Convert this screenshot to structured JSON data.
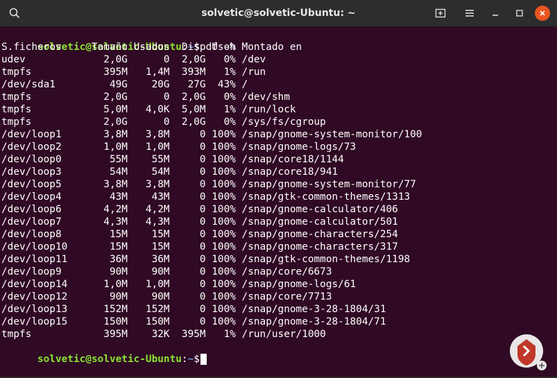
{
  "window": {
    "title": "solvetic@solvetic-Ubuntu: ~"
  },
  "icons": {
    "search": "search-icon",
    "new_tab": "new-tab-icon",
    "menu": "hamburger-menu-icon",
    "minimize": "minimize-icon",
    "maximize": "maximize-icon",
    "close": "close-icon"
  },
  "colors": {
    "background": "#300a24",
    "prompt_user": "#8ae234",
    "prompt_path": "#729fcf",
    "close_button": "#e95420",
    "text": "#ffffff"
  },
  "prompt": {
    "user_host": "solvetic@solvetic-Ubuntu",
    "colon": ":",
    "path": "~",
    "symbol": "$"
  },
  "command": " df -h",
  "output": {
    "header": "S.ficheros     Tamaño Usados  Disp Uso% Montado en",
    "rows": [
      "udev             2,0G      0  2,0G   0% /dev",
      "tmpfs            395M   1,4M  393M   1% /run",
      "/dev/sda1         49G    20G   27G  43% /",
      "tmpfs            2,0G      0  2,0G   0% /dev/shm",
      "tmpfs            5,0M   4,0K  5,0M   1% /run/lock",
      "tmpfs            2,0G      0  2,0G   0% /sys/fs/cgroup",
      "/dev/loop1       3,8M   3,8M     0 100% /snap/gnome-system-monitor/100",
      "/dev/loop2       1,0M   1,0M     0 100% /snap/gnome-logs/73",
      "/dev/loop0        55M    55M     0 100% /snap/core18/1144",
      "/dev/loop3        54M    54M     0 100% /snap/core18/941",
      "/dev/loop5       3,8M   3,8M     0 100% /snap/gnome-system-monitor/77",
      "/dev/loop4        43M    43M     0 100% /snap/gtk-common-themes/1313",
      "/dev/loop6       4,2M   4,2M     0 100% /snap/gnome-calculator/406",
      "/dev/loop7       4,3M   4,3M     0 100% /snap/gnome-calculator/501",
      "/dev/loop8        15M    15M     0 100% /snap/gnome-characters/254",
      "/dev/loop10       15M    15M     0 100% /snap/gnome-characters/317",
      "/dev/loop11       36M    36M     0 100% /snap/gtk-common-themes/1198",
      "/dev/loop9        90M    90M     0 100% /snap/core/6673",
      "/dev/loop14      1,0M   1,0M     0 100% /snap/gnome-logs/61",
      "/dev/loop12       90M    90M     0 100% /snap/core/7713",
      "/dev/loop13      152M   152M     0 100% /snap/gnome-3-28-1804/31",
      "/dev/loop15      150M   150M     0 100% /snap/gnome-3-28-1804/71",
      "tmpfs            395M    32K  395M   1% /run/user/1000"
    ]
  }
}
